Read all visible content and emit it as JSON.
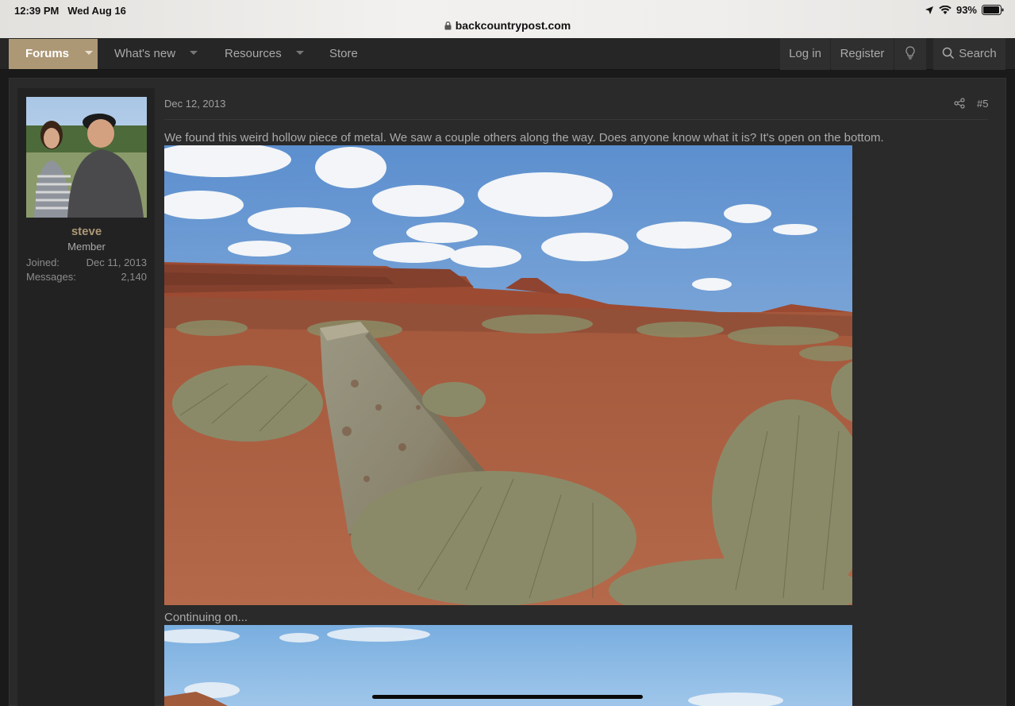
{
  "status_bar": {
    "time": "12:39 PM",
    "date": "Wed Aug 16",
    "battery": "93%",
    "url": "backcountrypost.com"
  },
  "nav": {
    "tabs": [
      {
        "label": "Forums",
        "active": true
      },
      {
        "label": "What's new"
      },
      {
        "label": "Resources"
      },
      {
        "label": "Store"
      }
    ],
    "login": "Log in",
    "register": "Register",
    "search": "Search"
  },
  "post": {
    "user": {
      "name": "steve",
      "title": "Member",
      "joined_label": "Joined:",
      "joined_value": "Dec 11, 2013",
      "messages_label": "Messages:",
      "messages_value": "2,140"
    },
    "date": "Dec 12, 2013",
    "number": "#5",
    "text": "We found this weird hollow piece of metal. We saw a couple others along the way. Does anyone know what it is? It's open on the bottom.",
    "continuation": "Continuing on..."
  },
  "colors": {
    "accent": "#ad9876",
    "nav_bg": "#262626",
    "page_bg": "#1b1b1b"
  }
}
